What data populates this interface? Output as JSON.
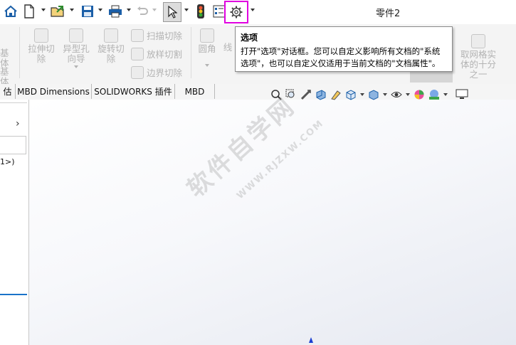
{
  "window": {
    "title": "零件2"
  },
  "quick_access": {
    "items": [
      "home-icon",
      "new-document-icon",
      "open-folder-icon",
      "save-icon",
      "print-icon",
      "undo-icon",
      "select-pointer-icon",
      "traffic-light-icon",
      "file-properties-icon",
      "options-gear-icon"
    ]
  },
  "ribbon": {
    "left_partial": [
      "基体",
      "基体"
    ],
    "extruded_cut": "拉伸切\n除",
    "hole_wizard": "异型孔\n向导",
    "revolved_cut": "旋转切\n除",
    "swept_cut": "扫描切除",
    "lofted_cut": "放样切割",
    "boundary_cut": "边界切除",
    "fillet": "圆角",
    "linear_partial": "线",
    "right_partial": "取网格实\n体的十分\n之一"
  },
  "tabs": [
    "估",
    "MBD Dimensions",
    "SOLIDWORKS 插件",
    "MBD"
  ],
  "left_panel": {
    "fragment": "1>)"
  },
  "tooltip": {
    "title": "选项",
    "body": "打开\"选项\"对话框。您可以自定义影响所有文档的\"系统选项\"，也可以自定义仅适用于当前文档的\"文档属性\"。"
  },
  "watermark": {
    "text": "软件自学网",
    "url": "WWW.RJZXW.COM"
  },
  "colors": {
    "highlight": "#e000e0",
    "accent_blue": "#1a73c9"
  }
}
